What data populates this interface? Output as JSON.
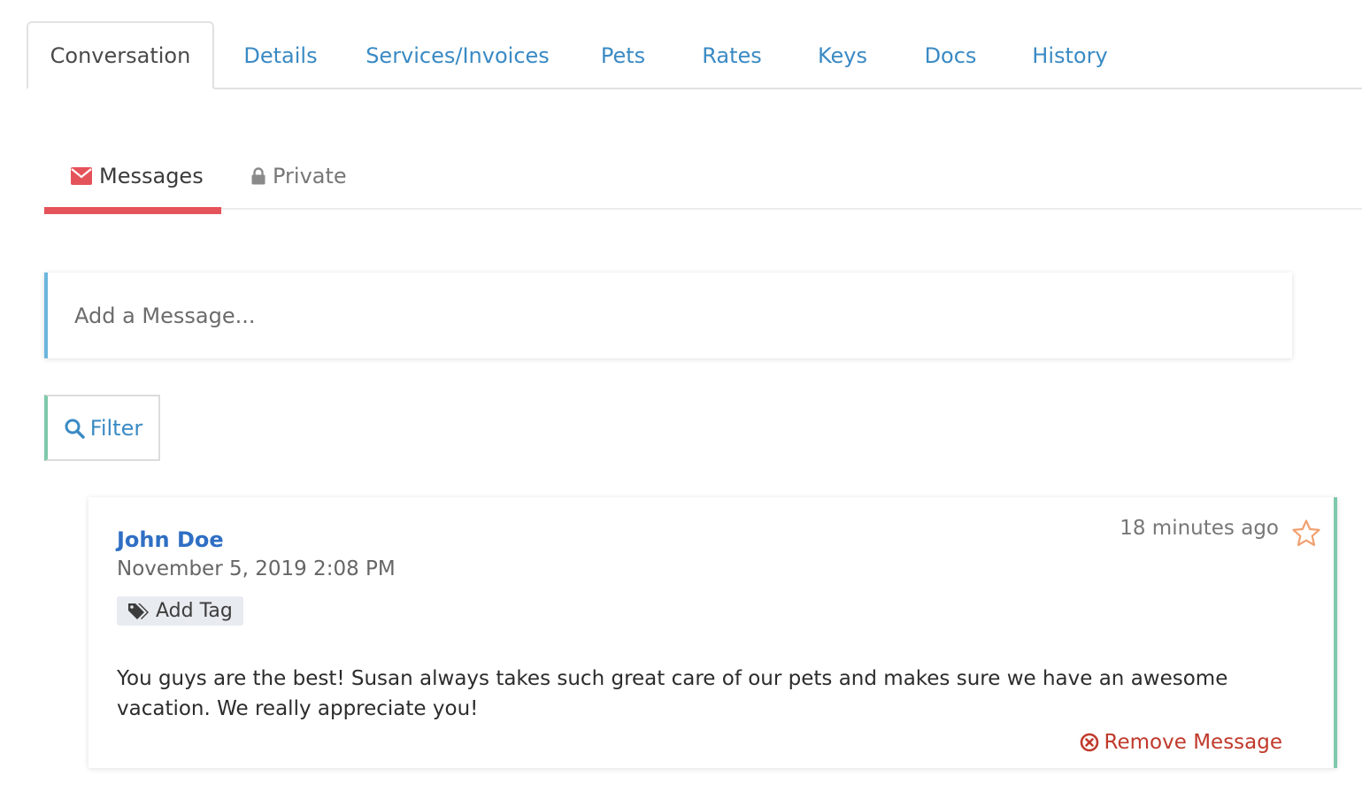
{
  "tabs": [
    {
      "label": "Conversation",
      "active": true
    },
    {
      "label": "Details"
    },
    {
      "label": "Services/Invoices"
    },
    {
      "label": "Pets"
    },
    {
      "label": "Rates"
    },
    {
      "label": "Keys"
    },
    {
      "label": "Docs"
    },
    {
      "label": "History"
    }
  ],
  "subtabs": {
    "messages": {
      "label": "Messages",
      "icon": "envelope-icon",
      "active": true
    },
    "private": {
      "label": "Private",
      "icon": "lock-icon"
    }
  },
  "compose": {
    "placeholder": "Add a Message..."
  },
  "filter": {
    "label": "Filter",
    "icon": "search-icon"
  },
  "message": {
    "author": "John Doe",
    "date": "November 5, 2019 2:08 PM",
    "time_ago": "18 minutes ago",
    "tag_label": "Add Tag",
    "body": "You guys are the best! Susan always takes such great care of our pets and makes sure we have an awesome vacation. We really appreciate you!",
    "remove_label": "Remove Message",
    "star_icon": "star-outline-icon"
  },
  "colors": {
    "link_blue": "#3a8ac4",
    "active_underline": "#e5535a",
    "input_accent": "#6cb6dd",
    "card_accent": "#7ec8ab",
    "author": "#2f6fc4",
    "remove": "#c0392b",
    "star": "#f0a070"
  }
}
